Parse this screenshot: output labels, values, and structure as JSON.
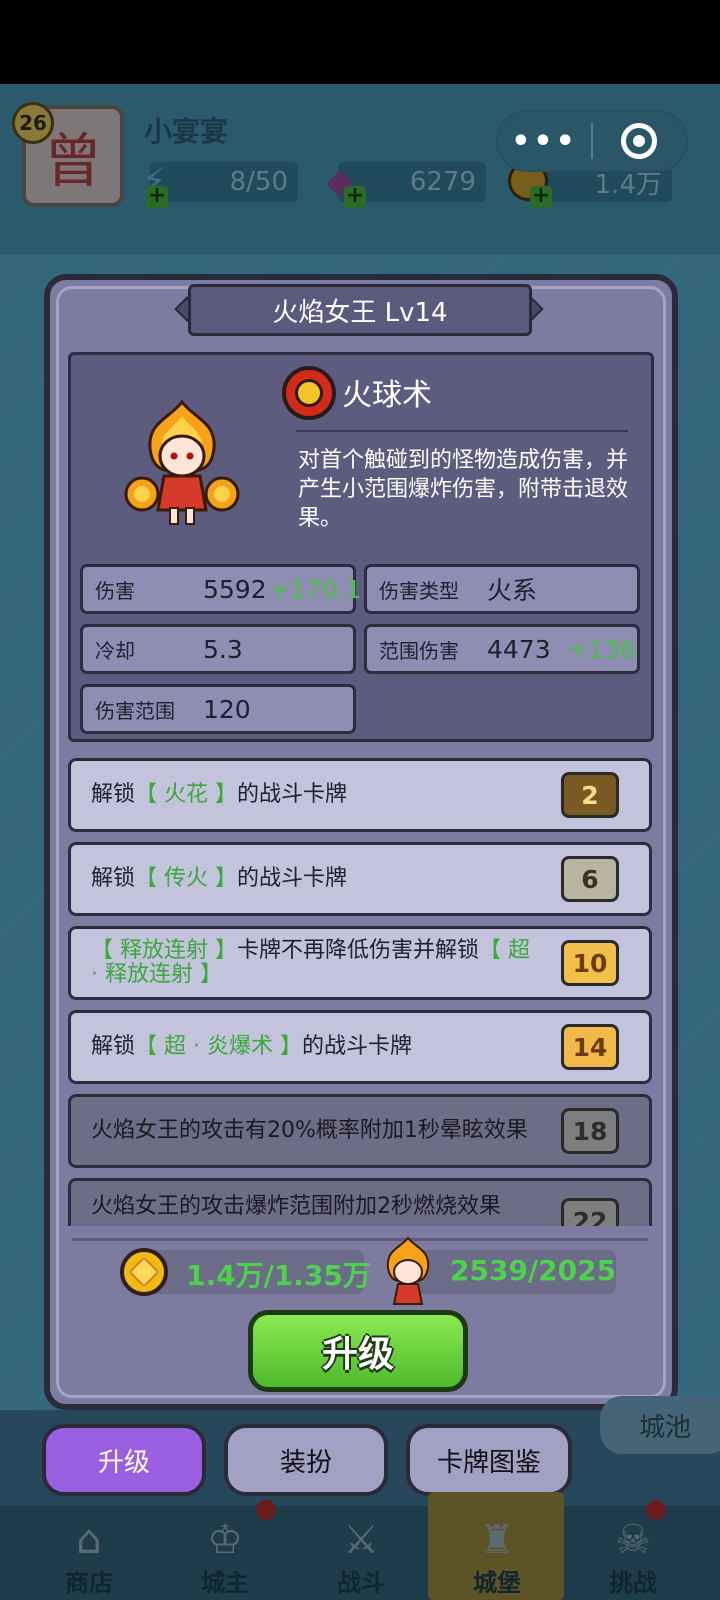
{
  "header": {
    "level": "26",
    "avatar_glyph": "曾",
    "player_name": "小宴宴",
    "energy": "8/50",
    "gems": "6279",
    "coins": "1.4万"
  },
  "capsule": {
    "more_label": "•••"
  },
  "panel": {
    "title": "火焰女王  Lv14",
    "skill": {
      "name": "火球术",
      "description": "对首个触碰到的怪物造成伤害，并产生小范围爆炸伤害，附带击退效果。"
    },
    "stats": {
      "damage_label": "伤害",
      "damage_value": "5592",
      "damage_inc": "+170.1",
      "damage_type_label": "伤害类型",
      "damage_type_value": "火系",
      "cooldown_label": "冷却",
      "cooldown_value": "5.3",
      "aoe_damage_label": "范围伤害",
      "aoe_damage_value": "4473",
      "aoe_damage_inc": "+136",
      "range_label": "伤害范围",
      "range_value": "120"
    },
    "perks": [
      {
        "pre": "解锁",
        "hl": "【 火花 】",
        "post": "的战斗卡牌",
        "level": "2"
      },
      {
        "pre": "解锁",
        "hl": "【 传火 】",
        "post": "的战斗卡牌",
        "level": "6"
      },
      {
        "pre": "",
        "hl": "【 释放连射 】",
        "post": "卡牌不再降低伤害并解锁",
        "hl2": "【 超 · 释放连射 】",
        "level": "10"
      },
      {
        "pre": "解锁",
        "hl": "【 超 · 炎爆术 】",
        "post": "的战斗卡牌",
        "level": "14"
      },
      {
        "text": "火焰女王的攻击有20%概率附加1秒晕眩效果",
        "level": "18"
      },
      {
        "text": "火焰女王的攻击爆炸范围附加2秒燃烧效果",
        "level": "22"
      }
    ],
    "cost_coins": "1.4万/1.35万",
    "cost_shards": "2539/2025",
    "upgrade_label": "升级"
  },
  "tabs": {
    "upgrade": "升级",
    "outfit": "装扮",
    "card_book": "卡牌图鉴",
    "city": "城池"
  },
  "nav": {
    "shop": "商店",
    "lord": "城主",
    "battle": "战斗",
    "castle": "城堡",
    "challenge": "挑战"
  },
  "colors": {
    "panel": "#7d7ca0",
    "skill_box": "#5d5c7f",
    "highlight_green": "#3aa83a",
    "upgrade_button": "#6fd63e",
    "active_tab": "#9a5fe0"
  }
}
